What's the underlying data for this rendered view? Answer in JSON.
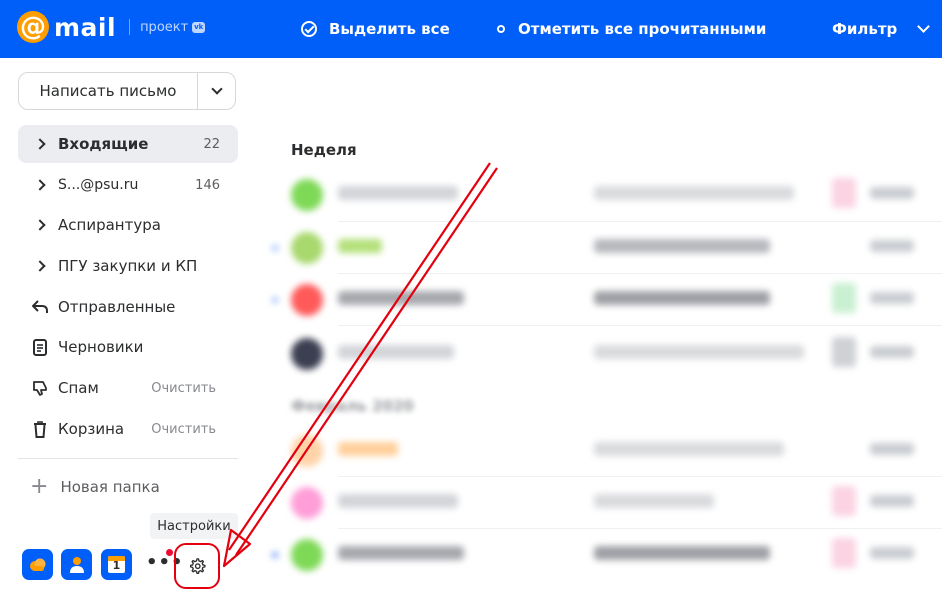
{
  "colors": {
    "brand": "#005ff9",
    "accent_orange": "#ff9e00",
    "annotation_red": "#e3000f"
  },
  "header": {
    "logo_symbol": "@",
    "logo_text": "mail",
    "project_label": "проект",
    "vk_badge": "vk",
    "select_all": "Выделить все",
    "mark_all_read": "Отметить все прочитанными",
    "filter": "Фильтр"
  },
  "sidebar": {
    "compose": "Написать письмо",
    "folders": [
      {
        "label": "Входящие",
        "count": "22",
        "icon": "chevron-right-icon"
      },
      {
        "label": "S...@psu.ru",
        "count": "146",
        "icon": "chevron-right-icon"
      },
      {
        "label": "Аспирантура",
        "icon": "chevron-right-icon"
      },
      {
        "label": "ПГУ закупки и КП",
        "icon": "chevron-right-icon"
      },
      {
        "label": "Отправленные",
        "icon": "reply-icon"
      },
      {
        "label": "Черновики",
        "icon": "draft-icon"
      },
      {
        "label": "Спам",
        "action": "Очистить",
        "icon": "thumb-down-icon"
      },
      {
        "label": "Корзина",
        "action": "Очистить",
        "icon": "trash-icon"
      }
    ],
    "new_folder": "Новая папка",
    "calendar_day": "1",
    "more": "•••",
    "settings_tooltip": "Настройки"
  },
  "main": {
    "section_week": "Неделя",
    "section_month": "Февраль 2020"
  }
}
